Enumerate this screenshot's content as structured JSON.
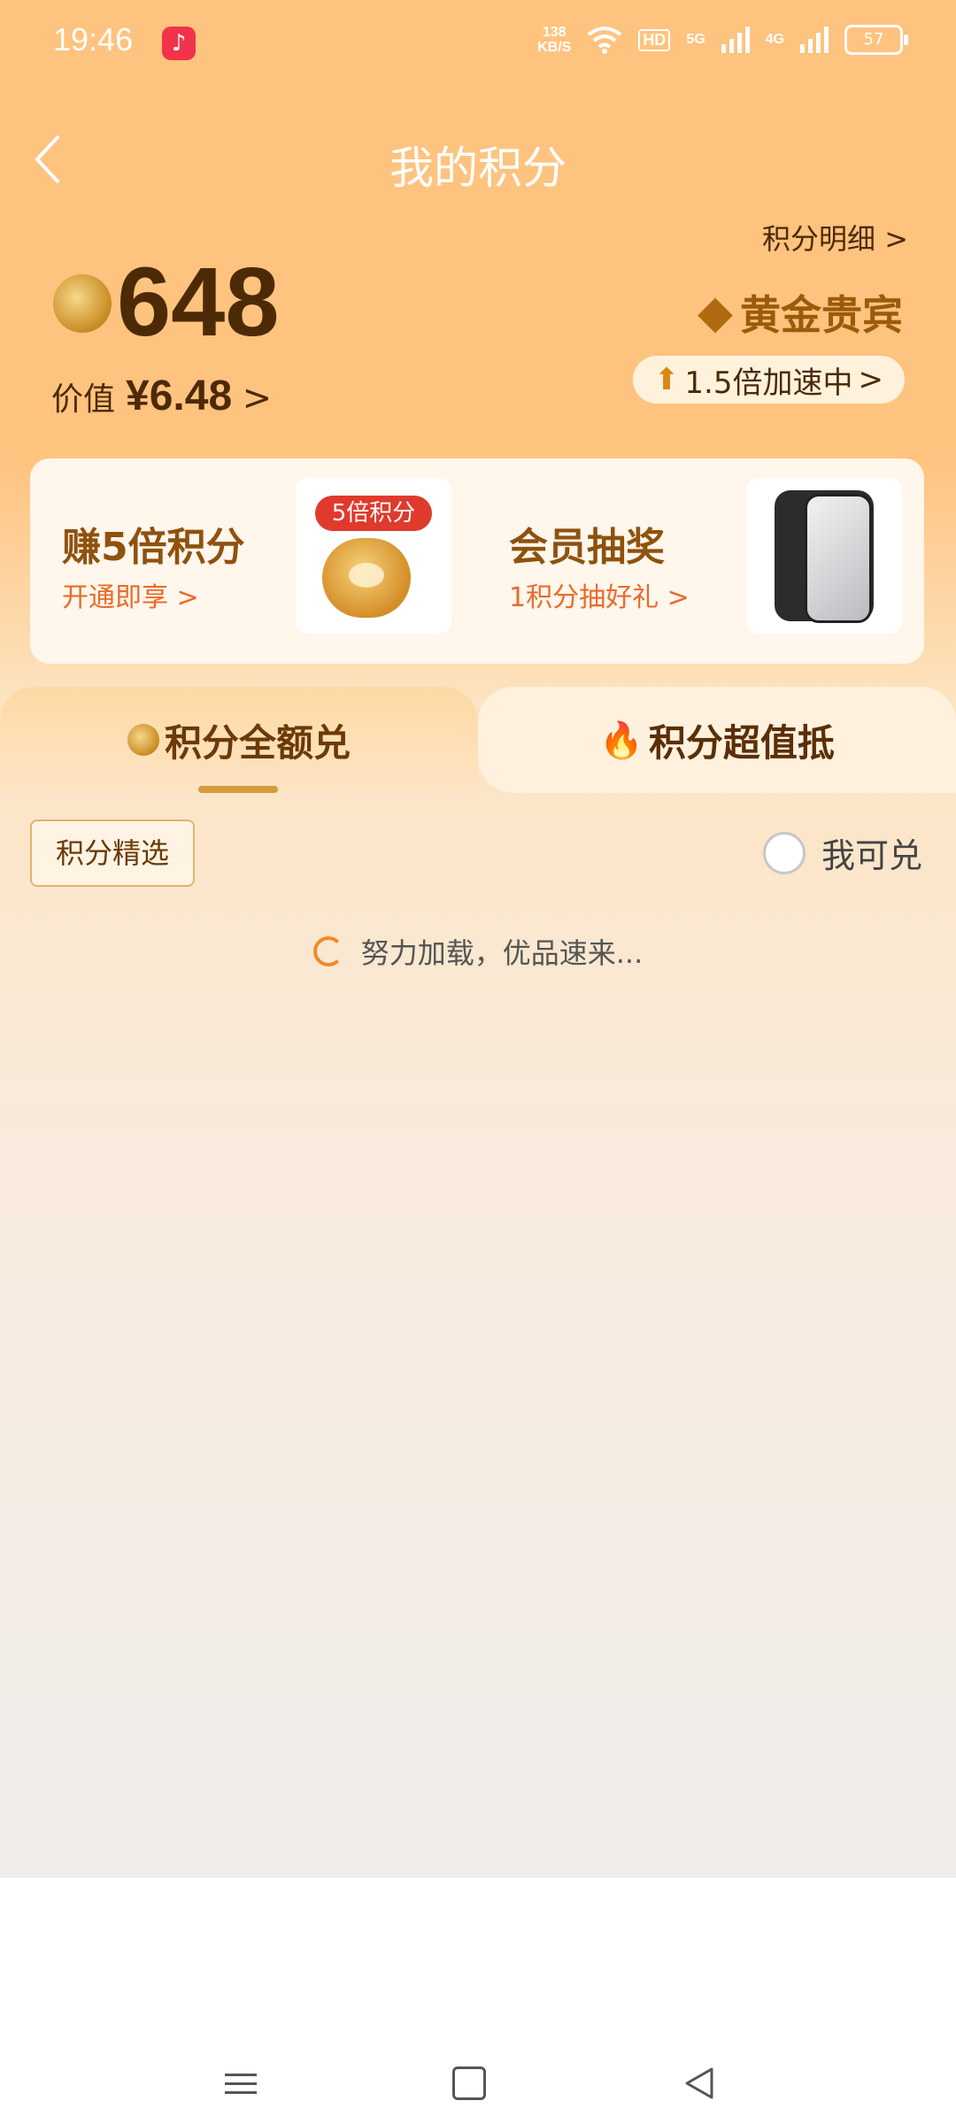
{
  "status_bar": {
    "time": "19:46",
    "net_speed_value": "138",
    "net_speed_unit": "KB/S",
    "hd_label": "HD",
    "signal_1": "5G",
    "signal_2": "4G",
    "battery": "57",
    "icons": [
      "music-app-icon",
      "wifi-icon",
      "signal-icon",
      "battery-icon"
    ]
  },
  "header": {
    "title": "我的积分",
    "detail_link": "积分明细",
    "back_icon": "chevron-left-icon"
  },
  "points": {
    "amount": "648",
    "value_label": "价值",
    "value_amount": "¥6.48"
  },
  "membership": {
    "level": "黄金贵宾",
    "speedup": "1.5倍加速中"
  },
  "promos": [
    {
      "title": "赚5倍积分",
      "subtitle": "开通即享",
      "badge": "5倍积分"
    },
    {
      "title": "会员抽奖",
      "subtitle": "1积分抽好礼"
    }
  ],
  "tabs": [
    {
      "label": "积分全额兑",
      "active": true
    },
    {
      "label": "积分超值抵",
      "active": false
    }
  ],
  "filters": {
    "chip": "积分精选",
    "checkbox_label": "我可兑",
    "checkbox_checked": false
  },
  "loading_text": "努力加载，优品速来...",
  "colors": {
    "header_bg": "#fec37f",
    "brown_text": "#4d2a06",
    "accent_orange": "#e86b2a",
    "gold": "#9c5b0b"
  }
}
